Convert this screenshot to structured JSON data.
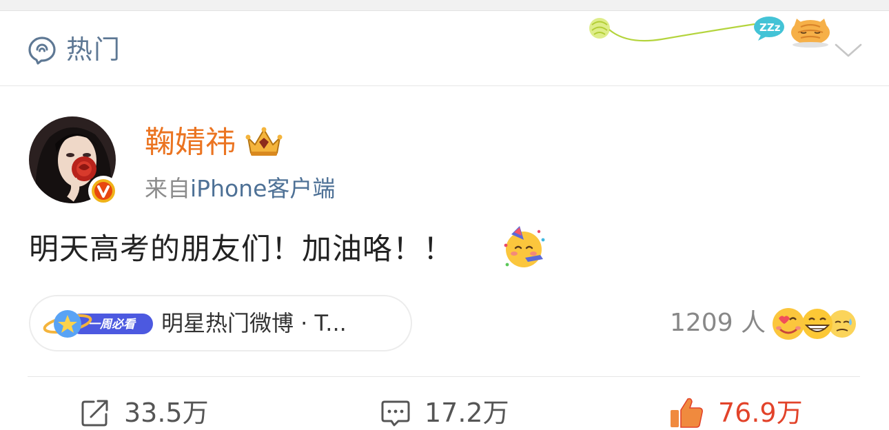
{
  "header": {
    "title": "热门",
    "title_color": "#5e7894"
  },
  "post": {
    "author": {
      "name": "鞠婧祎",
      "name_color": "#eb7421",
      "verified": true,
      "badge": "crown-icon"
    },
    "source_prefix": "来自",
    "source_client": "iPhone客户端",
    "text": "明天高考的朋友们！加油咯！！",
    "emoji": "partying-face-emoji",
    "topic": {
      "badge_label": "一周必看",
      "label": "明星热门微博 · T..."
    },
    "reactions": {
      "people": "1209 人",
      "faces": [
        "heart-kiss-emoji",
        "grin-emoji",
        "sweat-emoji"
      ]
    }
  },
  "actions": {
    "repost_count": "33.5万",
    "comment_count": "17.2万",
    "like_count": "76.9万",
    "like_color": "#e2432a"
  }
}
